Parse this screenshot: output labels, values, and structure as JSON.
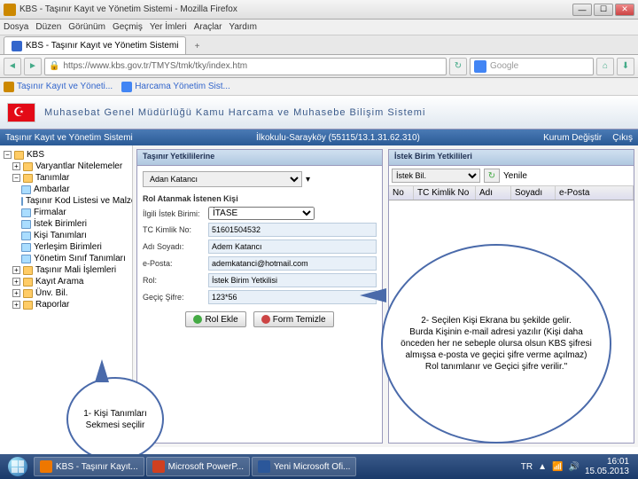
{
  "window": {
    "title": "KBS - Taşınır Kayıt ve Yönetim Sistemi - Mozilla Firefox"
  },
  "menu": {
    "items": [
      "Dosya",
      "Düzen",
      "Görünüm",
      "Geçmiş",
      "Yer İmleri",
      "Araçlar",
      "Yardım"
    ]
  },
  "browsertab": {
    "label": "KBS - Taşınır Kayıt ve Yönetim Sistemi"
  },
  "url": "https://www.kbs.gov.tr/TMYS/tmk/tky/index.htm",
  "search": {
    "placeholder": "Google"
  },
  "bookmarks": {
    "a": "Taşınır Kayıt ve Yöneti...",
    "b": "Harcama Yönetim Sist..."
  },
  "app": {
    "title": "Muhasebat Genel Müdürlüğü Kamu Harcama ve Muhasebe Bilişim Sistemi"
  },
  "crumb": {
    "left": "Taşınır Kayıt ve Yönetim Sistemi",
    "mid": "İlkokulu-Sarayköy (55115/13.1.31.62.310)",
    "r1": "Kurum Değiştir",
    "r2": "Çıkış"
  },
  "tree": {
    "root": "KBS",
    "n1": "Varyantlar Nitelemeler",
    "n2": "Tanımlar",
    "n2a": "Ambarlar",
    "n2b": "Taşınır Kod Listesi ve Malzemeler",
    "n2c": "Firmalar",
    "n2d": "İstek Birimleri",
    "n2e": "Kişi Tanımları",
    "n2f": "Yerleşim Birimleri",
    "n2g": "Yönetim Sınıf Tanımları",
    "n3": "Taşınır Mali İşlemleri",
    "n4": "Kayıt Arama",
    "n5": "Ünv. Bil.",
    "n6": "Raporlar"
  },
  "panelA": {
    "title": "Taşınır Yetkililerine",
    "select": "Adan Katancı",
    "section": "Rol Atanmak İstenen Kişi",
    "f1l": "İlgili İstek Birimi:",
    "f1v": "İTASE",
    "f2l": "TC Kimlik No:",
    "f2v": "51601504532",
    "f3l": "Adı Soyadı:",
    "f3v": "Adem Katancı",
    "f4l": "e-Posta:",
    "f4v": "ademkatanci@hotmail.com",
    "f5l": "Rol:",
    "f5v": "İstek Birim Yetkilisi",
    "f6l": "Geçiç Şifre:",
    "f6v": "123*56",
    "btn1": "Rol Ekle",
    "btn2": "Form Temizle"
  },
  "panelB": {
    "title": "İstek Birim Yetkilileri",
    "filter": "İstek Bil.",
    "action": "Yenile",
    "h1": "No",
    "h2": "TC Kimlik No",
    "h3": "Adı",
    "h4": "Soyadı",
    "h5": "e-Posta"
  },
  "callout1": "1- Kişi Tanımları Sekmesi seçilir",
  "callout2": "2- Seçilen Kişi Ekrana bu şekilde gelir.\nBurda Kişinin e-mail adresi yazılır (Kişi daha önceden her ne sebeple olursa olsun KBS şifresi almışsa e-posta ve geçici şifre verme açılmaz)\nRol tanımlanır ve Geçici şifre verilir.\"",
  "taskbar": {
    "t1": "KBS - Taşınır Kayıt...",
    "t2": "Microsoft PowerP...",
    "t3": "Yeni Microsoft Ofi...",
    "lang": "TR",
    "time": "16:01",
    "date": "15.05.2013"
  }
}
